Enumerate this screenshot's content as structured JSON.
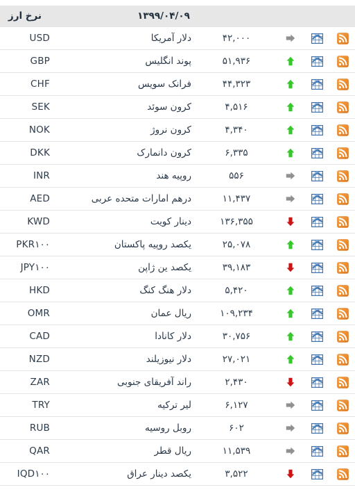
{
  "header": {
    "title": "نرخ ارز",
    "date": "۱۳۹۹/۰۴/۰۹"
  },
  "icons": {
    "rss": "rss-feed-icon",
    "chart": "price-chart-icon",
    "up": "arrow-up-icon",
    "down": "arrow-down-icon",
    "flat": "arrow-right-icon"
  },
  "colors": {
    "rss_orange": "#ef8521",
    "chart_blue": "#3f72ac",
    "up_green": "#36c72b",
    "down_red": "#cc1414",
    "flat_gray": "#909090",
    "header_bg": "#e7e7e7",
    "row_border": "#e4e4e4",
    "text": "#2b3a4a"
  },
  "rows": [
    {
      "code": "USD",
      "name": "دلار آمریکا",
      "value": "۴۲,۰۰۰",
      "trend": "flat"
    },
    {
      "code": "GBP",
      "name": "پوند انگلیس",
      "value": "۵۱,۹۳۶",
      "trend": "up"
    },
    {
      "code": "CHF",
      "name": "فرانک سویس",
      "value": "۴۴,۳۲۳",
      "trend": "up"
    },
    {
      "code": "SEK",
      "name": "کرون سوئد",
      "value": "۴,۵۱۶",
      "trend": "up"
    },
    {
      "code": "NOK",
      "name": "کرون نروژ",
      "value": "۴,۳۴۰",
      "trend": "up"
    },
    {
      "code": "DKK",
      "name": "کرون دانمارک",
      "value": "۶,۳۳۵",
      "trend": "up"
    },
    {
      "code": "INR",
      "name": "روپیه هند",
      "value": "۵۵۶",
      "trend": "flat"
    },
    {
      "code": "AED",
      "name": "درهم امارات متحده عربی",
      "value": "۱۱,۴۳۷",
      "trend": "flat"
    },
    {
      "code": "KWD",
      "name": "دینار کویت",
      "value": "۱۳۶,۳۵۵",
      "trend": "down"
    },
    {
      "code": "PKR۱۰۰",
      "name": "یکصد روپیه پاکستان",
      "value": "۲۵,۰۷۸",
      "trend": "up"
    },
    {
      "code": "JPY۱۰۰",
      "name": "یکصد ین ژاپن",
      "value": "۳۹,۱۸۳",
      "trend": "down"
    },
    {
      "code": "HKD",
      "name": "دلار هنگ کنگ",
      "value": "۵,۴۲۰",
      "trend": "up"
    },
    {
      "code": "OMR",
      "name": "ریال عمان",
      "value": "۱۰۹,۲۳۴",
      "trend": "up"
    },
    {
      "code": "CAD",
      "name": "دلار کانادا",
      "value": "۳۰,۷۵۶",
      "trend": "up"
    },
    {
      "code": "NZD",
      "name": "دلار نیوزیلند",
      "value": "۲۷,۰۲۱",
      "trend": "up"
    },
    {
      "code": "ZAR",
      "name": "راند آفریقای جنوبی",
      "value": "۲,۴۳۰",
      "trend": "down"
    },
    {
      "code": "TRY",
      "name": "لیر ترکیه",
      "value": "۶,۱۲۷",
      "trend": "flat"
    },
    {
      "code": "RUB",
      "name": "روبل روسیه",
      "value": "۶۰۲",
      "trend": "flat"
    },
    {
      "code": "QAR",
      "name": "ریال قطر",
      "value": "۱۱,۵۳۹",
      "trend": "flat"
    },
    {
      "code": "IQD۱۰۰",
      "name": "یکصد دینار عراق",
      "value": "۳,۵۲۲",
      "trend": "down"
    }
  ]
}
